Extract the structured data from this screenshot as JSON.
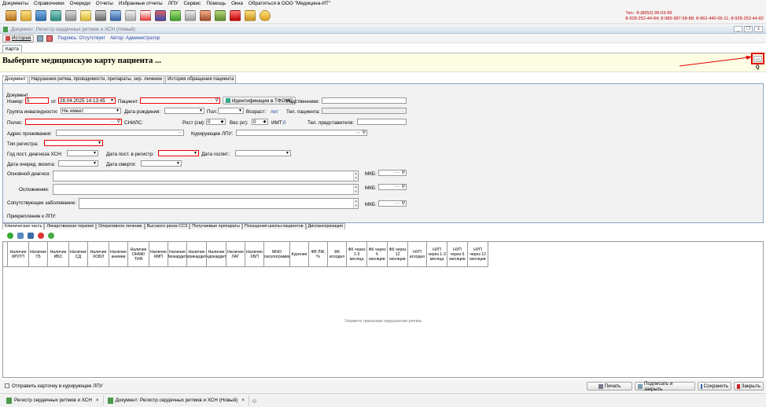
{
  "menu": [
    "Документы",
    "Справочники",
    "Очереди",
    "Отчеты",
    "Избранные отчеты",
    "ЛПУ",
    "Сервис",
    "Помощь",
    "Окна",
    "Обратиться в ООО \"Медицина-ИТ\""
  ],
  "contacts": {
    "line1": "Тел.: 8-(8652) 99-03-99",
    "line2": "8-928-252-44-84; 8-989-987-58-88; 8-962-440-09-11; 8-928-252-44-82"
  },
  "window": {
    "title": "Документ: Регистр сердечных ритмов и ХСН (Новый)",
    "close_label": "x"
  },
  "doc_toolbar": {
    "history": "История",
    "sign_status": "Подпись: Отсутствует",
    "author": "Автор: Администратор"
  },
  "card_tab": "Карта",
  "header": {
    "prompt": "Выберите медицинскую карту пациента ...",
    "pick_label": "...",
    "search_label": "Q"
  },
  "tabs": [
    "Документ",
    "Нарушения ритма, проводимости, препараты, хир. лечение",
    "История обращения пациента"
  ],
  "form": {
    "group": "Документ",
    "number_label": "Номер:",
    "number": "5",
    "from_label": "от",
    "date": "28.04.2025 14:13:45",
    "patient_label": "Пациент:",
    "tfoms_button": "Идентификация в ТФОМС",
    "relatives_label": "Родственники:",
    "disability_label": "Группа инвалидности:",
    "disability": "Не имеет",
    "birth_label": "Дата рождения:",
    "sex_label": "Пол:",
    "age_label": "Возраст:",
    "age_unit": "лет",
    "phone_label": "Тел. пациента:",
    "policy_label": "Полис:",
    "snils_label": "СНИЛС:",
    "height_label": "Рост (см):",
    "height": "0",
    "weight_label": "Вес (кг):",
    "weight": "0",
    "bmi_label": "ИМТ:",
    "bmi": "0",
    "rep_phone_label": "Тел. представителя:",
    "address_label": "Адрес проживания:",
    "lpu_label": "Курирующее ЛПУ:",
    "register_type_label": "Тип регистра:",
    "hsn_year_label": "Год пост. диагноза ХСН:",
    "reg_date_label": "Дата пост. в регистр:",
    "hosp_date_label": "Дата госпит.:",
    "visit_label": "Дата очеред. визита:",
    "death_label": "Дата смерти:",
    "main_diag_label": "Основной диагноз:",
    "complication_label": "Осложнение:",
    "concomitant_label": "Сопутствующее заболевание:",
    "mkb_label": "МКБ:",
    "attach_label": "Прикрепление к ЛПУ:"
  },
  "subtabs": [
    "Клиническая часть",
    "Лекарственная терапия",
    "Оперативное лечение",
    "Высокого риска ССЗ",
    "Получаемые препараты",
    "Посещения школы пациентов",
    "Диспансеризация"
  ],
  "grid": {
    "columns": [
      "Наличие ФП/ТП",
      "Наличие ГБ",
      "Наличие ИБС",
      "Наличие СД",
      "Наличие ХОБЛ",
      "Наличие анемии",
      "Наличие ОНМК/ТИА",
      "Наличие КМП",
      "Наличие Миокардита",
      "Наличие перикардита",
      "Наличие эндокардита",
      "Наличие ЛАГ",
      "Наличие ХБП",
      "МНО коагулограммы",
      "Курение",
      "ФВ ЛЖ, %",
      "ФК исходно",
      "ФК через 1-3 месяца",
      "ФК через 6 месяцев",
      "ФК через 12 месяцев",
      "НУП исходно",
      "НУП через 1-3 месяца",
      "НУП через 6 месяцев",
      "НУП через 12 месяцев"
    ],
    "empty_text": "Укажите признаки нарушения ритма"
  },
  "bottom": {
    "send_label": "Отправить карточку в курирующее ЛПУ",
    "print": "Печать",
    "sign_close": "Подписать и закрыть",
    "save": "Сохранить",
    "close": "Закрыть"
  },
  "taskbar": [
    "Регистр сердечных ритмов и ХСН",
    "Документ: Регистр сердечных ритмов и ХСН (Новый)"
  ]
}
